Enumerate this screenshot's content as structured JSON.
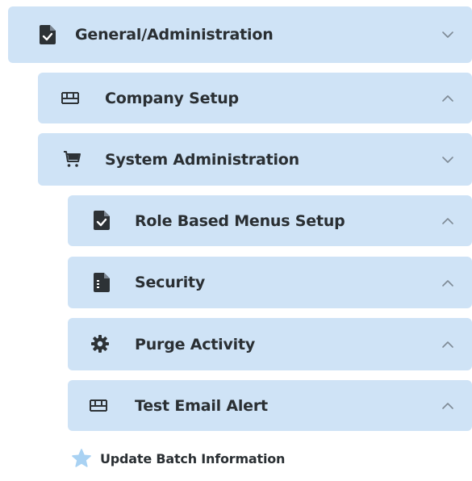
{
  "menu": {
    "general": {
      "label": "General/Administration",
      "state": "collapsed",
      "icon": "document-check-icon"
    },
    "company_setup": {
      "label": "Company Setup",
      "state": "expanded",
      "icon": "bed-icon"
    },
    "system_admin": {
      "label": "System Administration",
      "state": "collapsed",
      "icon": "cart-icon"
    },
    "role_menus": {
      "label": "Role Based Menus Setup",
      "state": "expanded",
      "icon": "document-check-icon"
    },
    "security": {
      "label": "Security",
      "state": "expanded",
      "icon": "document-list-icon"
    },
    "purge": {
      "label": "Purge Activity",
      "state": "expanded",
      "icon": "gear-icon"
    },
    "test_email": {
      "label": "Test Email Alert",
      "state": "expanded",
      "icon": "bed-icon"
    },
    "update_batch": {
      "label": "Update Batch Information",
      "icon": "star-icon"
    }
  },
  "colors": {
    "row_bg": "#cfe3f6",
    "text": "#2a2f33",
    "icon": "#2d3236",
    "chevron": "#7e8a95",
    "star": "#a9d2f3"
  }
}
